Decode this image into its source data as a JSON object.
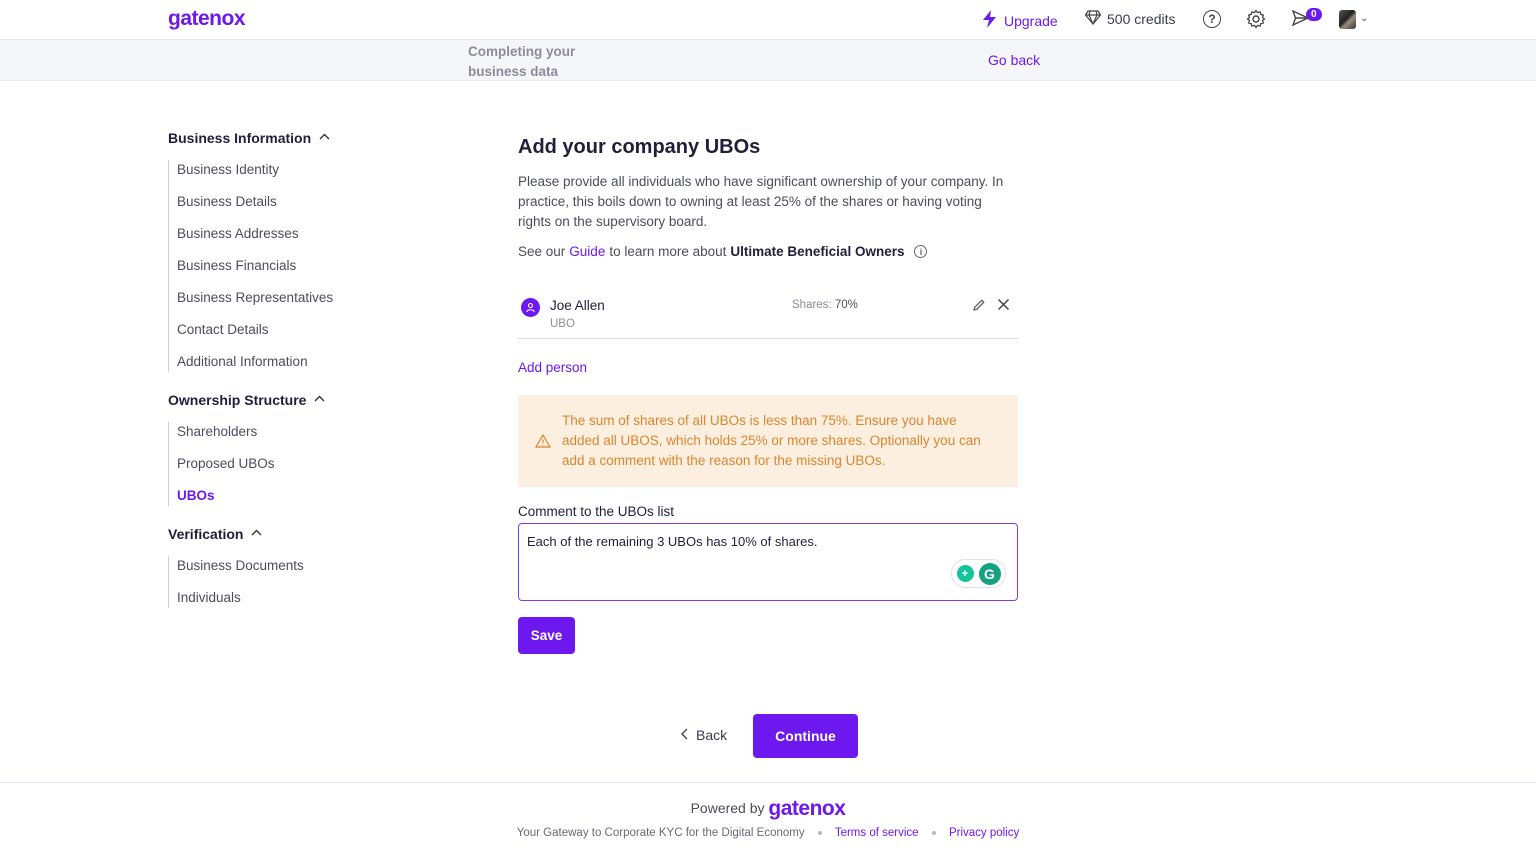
{
  "app": {
    "logo_text": "gatenox",
    "accent_color": "#6d18ef"
  },
  "topbar": {
    "upgrade_label": "Upgrade",
    "credits_label": "500 credits",
    "notifications_count": "0",
    "icons": [
      "bolt-icon",
      "diamond-icon",
      "help-icon",
      "gear-icon",
      "send-icon",
      "avatar",
      "chevron-down-icon"
    ]
  },
  "subbar": {
    "title": "Completing your business data",
    "go_back_label": "Go back"
  },
  "sidebar": {
    "sections": [
      {
        "title": "Business Information",
        "items": [
          "Business Identity",
          "Business Details",
          "Business Addresses",
          "Business Financials",
          "Business Representatives",
          "Contact Details",
          "Additional Information"
        ]
      },
      {
        "title": "Ownership Structure",
        "items": [
          "Shareholders",
          "Proposed UBOs",
          "UBOs"
        ]
      },
      {
        "title": "Verification",
        "items": [
          "Business Documents",
          "Individuals"
        ]
      }
    ],
    "active_item": "UBOs"
  },
  "main": {
    "title": "Add your company UBOs",
    "description": "Please provide all individuals who have significant ownership of your company. In practice, this boils down to owning at least 25% of the shares or having voting rights on the supervisory board.",
    "guide_prefix": "See our",
    "guide_link": "Guide",
    "guide_middle": "to learn more about",
    "guide_term": "Ultimate Beneficial Owners",
    "ubos": [
      {
        "name": "Joe Allen",
        "role": "UBO",
        "shares_label": "Shares:",
        "shares_value": "70%"
      }
    ],
    "add_person_label": "Add person",
    "warning_text": "The sum of shares of all UBOs is less than 75%. Ensure you have added all UBOS, which holds 25% or more shares. Optionally you can add a comment with the reason for the missing UBOs.",
    "comment_label": "Comment to the UBOs list",
    "comment_value": "Each of the remaining 3 UBOs has 10% of shares.",
    "save_label": "Save",
    "back_label": "Back",
    "continue_label": "Continue"
  },
  "footer": {
    "powered_by": "Powered by",
    "logo_text": "gatenox",
    "tagline": "Your Gateway to Corporate KYC for the Digital Economy",
    "terms_label": "Terms of service",
    "privacy_label": "Privacy policy"
  }
}
